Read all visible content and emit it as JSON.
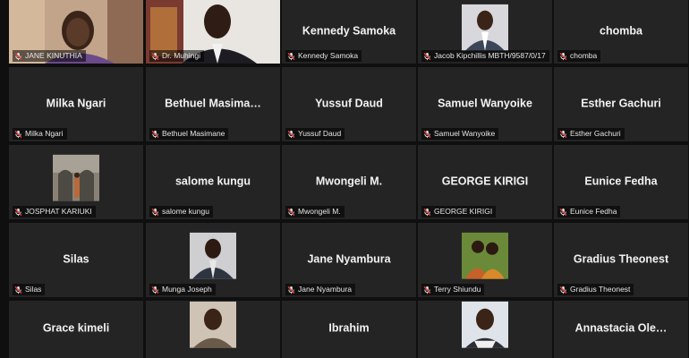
{
  "participants": [
    {
      "label": "JANE KINUTHIA",
      "center": "",
      "kind": "video-woman"
    },
    {
      "label": "Dr. Muhingi",
      "center": "",
      "kind": "video-man"
    },
    {
      "label": "Kennedy Samoka",
      "center": "Kennedy Samoka",
      "kind": "name"
    },
    {
      "label": "Jacob Kipchillis MBTH/9587/0/17",
      "center": "",
      "kind": "photo-suit"
    },
    {
      "label": "chomba",
      "center": "chomba",
      "kind": "name"
    },
    {
      "label": "Milka Ngari",
      "center": "Milka Ngari",
      "kind": "name"
    },
    {
      "label": "Bethuel Masimane",
      "center": "Bethuel  Masima…",
      "kind": "name"
    },
    {
      "label": "Yussuf Daud",
      "center": "Yussuf Daud",
      "kind": "name"
    },
    {
      "label": "Samuel Wanyoike",
      "center": "Samuel Wanyoike",
      "kind": "name"
    },
    {
      "label": "Esther Gachuri",
      "center": "Esther Gachuri",
      "kind": "name"
    },
    {
      "label": "JOSPHAT KARIUKI",
      "center": "",
      "kind": "photo-arch"
    },
    {
      "label": "salome kungu",
      "center": "salome kungu",
      "kind": "name"
    },
    {
      "label": "Mwongeli M.",
      "center": "Mwongeli M.",
      "kind": "name"
    },
    {
      "label": "GEORGE KIRIGI",
      "center": "GEORGE KIRIGI",
      "kind": "name"
    },
    {
      "label": "Eunice Fedha",
      "center": "Eunice Fedha",
      "kind": "name"
    },
    {
      "label": "Silas",
      "center": "Silas",
      "kind": "name"
    },
    {
      "label": "Munga Joseph",
      "center": "",
      "kind": "photo-man"
    },
    {
      "label": "Jane Nyambura",
      "center": "Jane Nyambura",
      "kind": "name"
    },
    {
      "label": "Terry Shiundu",
      "center": "",
      "kind": "photo-couple"
    },
    {
      "label": "Gradius Theonest",
      "center": "Gradius Theonest",
      "kind": "name"
    },
    {
      "label": "",
      "center": "Grace kimeli",
      "kind": "name"
    },
    {
      "label": "",
      "center": "",
      "kind": "photo-woman"
    },
    {
      "label": "",
      "center": "Ibrahim",
      "kind": "name"
    },
    {
      "label": "",
      "center": "",
      "kind": "photo-woman2"
    },
    {
      "label": "",
      "center": "Annastacia  Ole…",
      "kind": "name"
    }
  ],
  "colors": {
    "active_border": "#d9d24a",
    "muted_mic": "#e0403a",
    "tile_bg": "#242424"
  }
}
